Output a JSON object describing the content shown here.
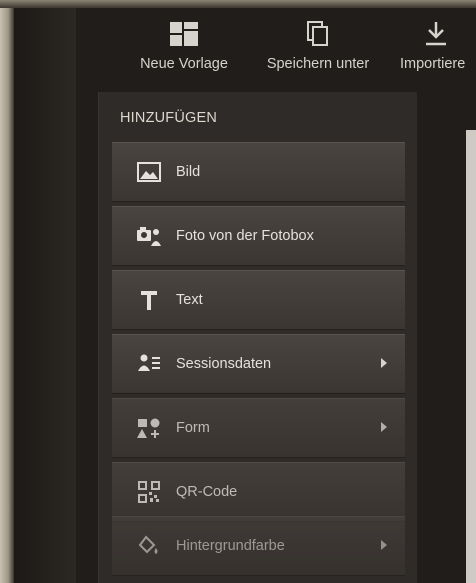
{
  "toolbar": {
    "new_template": "Neue Vorlage",
    "save_as": "Speichern unter",
    "import": "Importiere"
  },
  "panel": {
    "header": "HINZUFÜGEN",
    "items": [
      {
        "label": "Bild",
        "icon": "image-icon",
        "submenu": false
      },
      {
        "label": "Foto von der Fotobox",
        "icon": "photobooth-icon",
        "submenu": false
      },
      {
        "label": "Text",
        "icon": "text-icon",
        "submenu": false
      },
      {
        "label": "Sessionsdaten",
        "icon": "session-data-icon",
        "submenu": true
      },
      {
        "label": "Form",
        "icon": "shape-icon",
        "submenu": true
      },
      {
        "label": "QR-Code",
        "icon": "qr-code-icon",
        "submenu": false
      },
      {
        "label": "Hintergrundfarbe",
        "icon": "background-color-icon",
        "submenu": true
      }
    ]
  }
}
